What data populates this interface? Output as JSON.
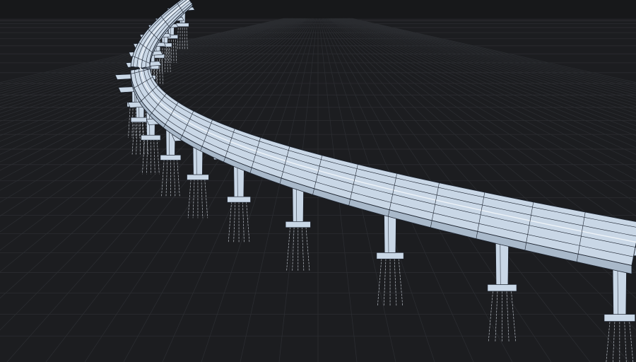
{
  "viewport": {
    "mode": "3d-wireframe-shaded",
    "background_color": "#1c1d20",
    "sky_color": "#17181a",
    "grid_color": "#2b2d31",
    "model_fill_color": "#c9d7e6",
    "model_edge_color": "#1d2430",
    "pile_color": "#cfd6df"
  },
  "scene": {
    "object": "elevated-viaduct-bridge",
    "components": [
      "deck",
      "pier-cap",
      "pier-column",
      "pile-cap",
      "piles"
    ],
    "visible_pier_count": 17
  }
}
